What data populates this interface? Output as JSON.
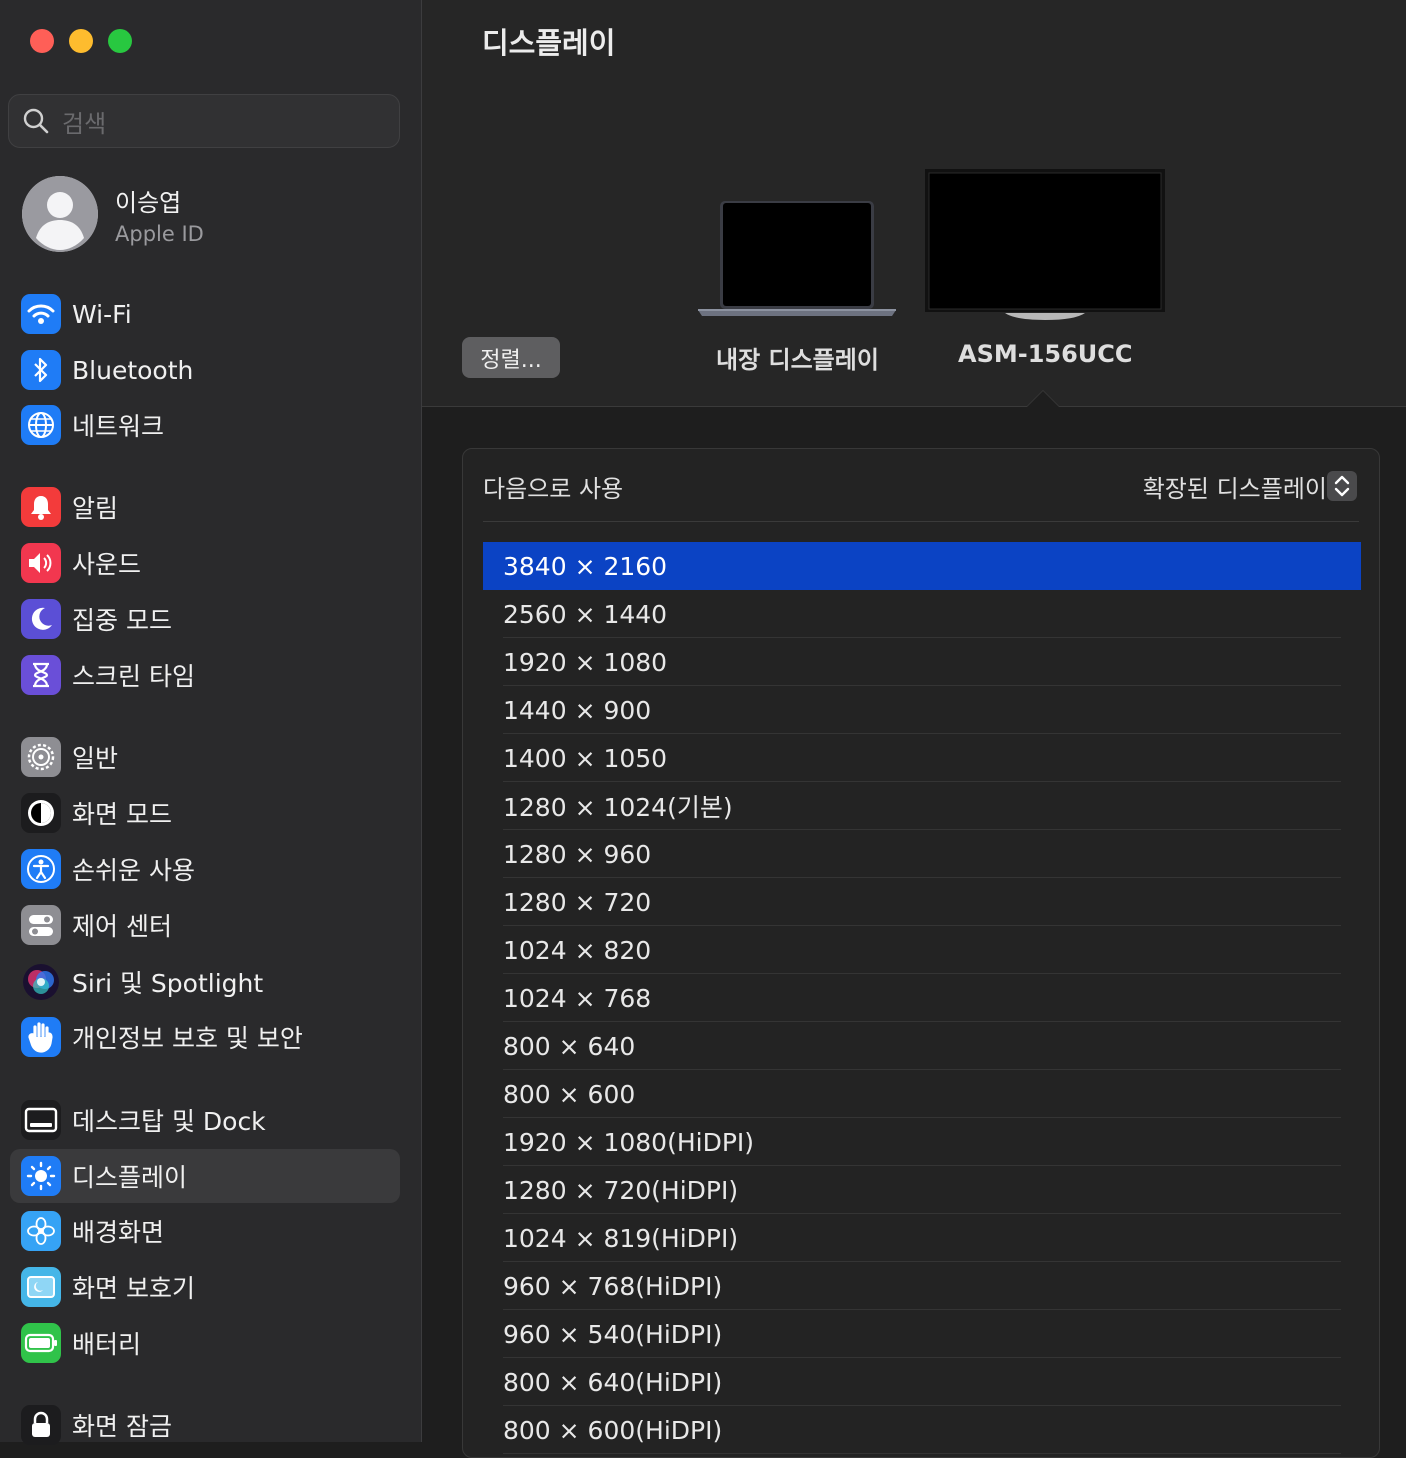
{
  "window": {
    "title": "디스플레이"
  },
  "search": {
    "placeholder": "검색"
  },
  "account": {
    "name": "이승엽",
    "subtitle": "Apple ID"
  },
  "sidebar": {
    "items": [
      {
        "label": "Wi-Fi",
        "icon": "wifi-icon",
        "color": "#1f7cf6"
      },
      {
        "label": "Bluetooth",
        "icon": "bluetooth-icon",
        "color": "#1f7cf6"
      },
      {
        "label": "네트워크",
        "icon": "globe-icon",
        "color": "#1f7cf6"
      },
      {
        "label": "알림",
        "icon": "bell-icon",
        "color": "#f33b3b"
      },
      {
        "label": "사운드",
        "icon": "speaker-icon",
        "color": "#f2374f"
      },
      {
        "label": "집중 모드",
        "icon": "moon-icon",
        "color": "#5b4fd6"
      },
      {
        "label": "스크린 타임",
        "icon": "hourglass-icon",
        "color": "#6a4fd8"
      },
      {
        "label": "일반",
        "icon": "gear-icon",
        "color": "#8e8e93"
      },
      {
        "label": "화면 모드",
        "icon": "appearance-icon",
        "color": "#1c1c1e"
      },
      {
        "label": "손쉬운 사용",
        "icon": "accessibility-icon",
        "color": "#1f7cf6"
      },
      {
        "label": "제어 센터",
        "icon": "toggles-icon",
        "color": "#8e8e93"
      },
      {
        "label": "Siri 및 Spotlight",
        "icon": "siri-icon",
        "color": "#2a2a2c"
      },
      {
        "label": "개인정보 보호 및 보안",
        "icon": "hand-icon",
        "color": "#1f7cf6"
      },
      {
        "label": "데스크탑 및 Dock",
        "icon": "dock-icon",
        "color": "#1c1c1e"
      },
      {
        "label": "디스플레이",
        "icon": "sun-icon",
        "color": "#1f7cf6",
        "selected": true
      },
      {
        "label": "배경화면",
        "icon": "flower-icon",
        "color": "#36a3f5"
      },
      {
        "label": "화면 보호기",
        "icon": "screensaver-icon",
        "color": "#45b6e8"
      },
      {
        "label": "배터리",
        "icon": "battery-icon",
        "color": "#30c34a"
      },
      {
        "label": "화면 잠금",
        "icon": "lock-icon",
        "color": "#1c1c1e"
      }
    ]
  },
  "arrangement": {
    "button_label": "정렬...",
    "displays": [
      {
        "label": "내장 디스플레이"
      },
      {
        "label": "ASM-156UCC",
        "selected": true
      }
    ]
  },
  "settings": {
    "use_as_label": "다음으로 사용",
    "use_as_value": "확장된 디스플레이",
    "resolutions": [
      "3840 × 2160",
      "2560 × 1440",
      "1920 × 1080",
      "1440 × 900",
      "1400 × 1050",
      "1280 × 1024(기본)",
      "1280 × 960",
      "1280 × 720",
      "1024 × 820",
      "1024 × 768",
      "800 × 640",
      "800 × 600",
      "1920 × 1080(HiDPI)",
      "1280 × 720(HiDPI)",
      "1024 × 819(HiDPI)",
      "960 × 768(HiDPI)",
      "960 × 540(HiDPI)",
      "800 × 640(HiDPI)",
      "800 × 600(HiDPI)"
    ],
    "selected_resolution": "3840 × 2160"
  }
}
